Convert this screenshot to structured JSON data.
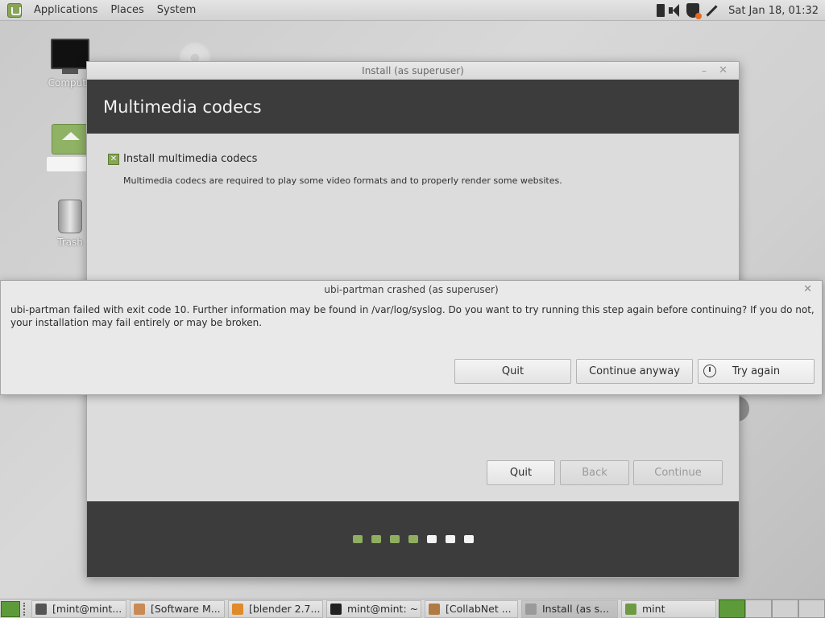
{
  "top_panel": {
    "menus": [
      "Applications",
      "Places",
      "System"
    ],
    "clock": "Sat Jan 18, 01:32",
    "tray_icons": [
      "keyboard-icon",
      "volume-icon",
      "shield-update-icon",
      "network-icon"
    ]
  },
  "desktop": {
    "icons": [
      {
        "label": "Computer",
        "icon": "computer-icon"
      },
      {
        "label": "",
        "icon": "home-folder-icon"
      },
      {
        "label": "Trash",
        "icon": "trash-icon"
      },
      {
        "label": "",
        "icon": "disc-icon"
      }
    ],
    "visible_labels": {
      "computer": "Compute",
      "trash": "Trash"
    }
  },
  "installer": {
    "window_title": "Install (as superuser)",
    "heading": "Multimedia codecs",
    "checkbox_label": "Install multimedia codecs",
    "checkbox_checked": true,
    "description": "Multimedia codecs are required to play some video formats and to properly render some websites.",
    "buttons": {
      "quit": "Quit",
      "back": "Back",
      "continue": "Continue"
    },
    "progress": {
      "completed": 4,
      "total": 7
    }
  },
  "crash_dialog": {
    "title": "ubi-partman crashed (as superuser)",
    "message": "ubi-partman failed with exit code 10. Further information may be found in /var/log/syslog. Do you want to try running this step again before continuing? If you do not, your installation may fail entirely or may be broken.",
    "buttons": {
      "quit": "Quit",
      "continue_anyway": "Continue anyway",
      "try_again": "Try again"
    }
  },
  "taskbar": {
    "tasks": [
      {
        "label": "[mint@mint...",
        "icon_color": "#555555"
      },
      {
        "label": "[Software M...",
        "icon_color": "#c98a54"
      },
      {
        "label": "[blender 2.7...",
        "icon_color": "#e08a2a"
      },
      {
        "label": "mint@mint: ~",
        "icon_color": "#222222"
      },
      {
        "label": "[CollabNet ...",
        "icon_color": "#b07a42"
      },
      {
        "label": "Install (as s...",
        "icon_color": "#9a9a9a"
      },
      {
        "label": "mint",
        "icon_color": "#6e9a44"
      }
    ],
    "workspaces": 4,
    "active_workspace": 1
  },
  "colors": {
    "accent": "#87a556",
    "header_dark": "#3c3c3c",
    "panel": "#dcdcdc"
  }
}
